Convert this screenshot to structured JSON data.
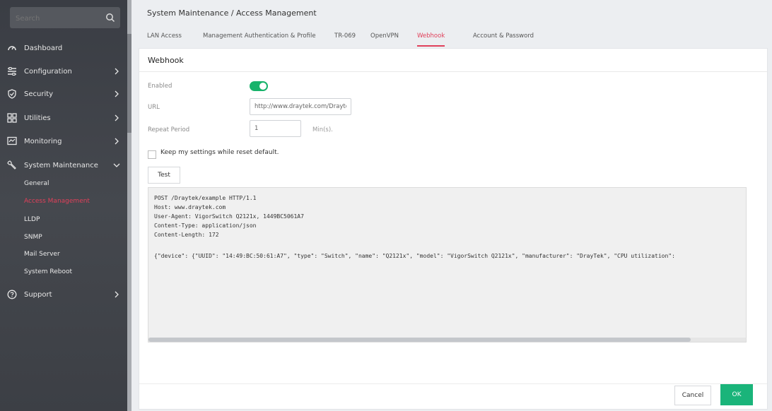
{
  "sidebar": {
    "search_placeholder": "Search",
    "items": [
      {
        "label": "Dashboard",
        "icon": "dashboard-gauge-icon"
      },
      {
        "label": "Configuration",
        "icon": "configuration-sliders-icon"
      },
      {
        "label": "Security",
        "icon": "security-shield-icon"
      },
      {
        "label": "Utilities",
        "icon": "utilities-grid-icon"
      },
      {
        "label": "Monitoring",
        "icon": "monitoring-screen-icon"
      },
      {
        "label": "System Maintenance",
        "icon": "wrench-icon"
      },
      {
        "label": "Support",
        "icon": "support-question-icon"
      }
    ],
    "subitems": [
      "General",
      "Access Management",
      "LLDP",
      "SNMP",
      "Mail Server",
      "System Reboot"
    ],
    "active_subitem_color": "#e0405a"
  },
  "header": {
    "title": "System Maintenance / Access Management",
    "tabs": [
      "LAN Access",
      "Management Authentication & Profile",
      "TR-069",
      "OpenVPN",
      "Webhook",
      "Account & Password"
    ],
    "active_tab": "Webhook"
  },
  "webhook": {
    "title": "Webhook",
    "enabled_label": "Enabled",
    "enabled": true,
    "url_label": "URL",
    "url_value": "http://www.draytek.com/Drayte",
    "repeat_label": "Repeat Period",
    "repeat_value": "1",
    "repeat_unit": "Min(s).",
    "keep_settings_label": "Keep my settings while reset default.",
    "test_label": "Test",
    "output_lines": [
      "POST /Draytek/example HTTP/1.1",
      "Host: www.draytek.com",
      "User-Agent: VigorSwitch Q2121x, 1449BC5061A7",
      "Content-Type: application/json",
      "Content-Length: 172",
      "",
      "{\"device\": {\"UUID\": \"14:49:BC:50:61:A7\", \"type\": \"Switch\", \"name\": \"Q2121x\", \"model\": \"VigorSwitch Q2121x\", \"manufacturer\": \"DrayTek\", \"CPU utilization\":"
    ]
  },
  "footer": {
    "cancel_label": "Cancel",
    "ok_label": "OK"
  },
  "colors": {
    "accent": "#e0405a",
    "primary": "#1ab47a"
  }
}
